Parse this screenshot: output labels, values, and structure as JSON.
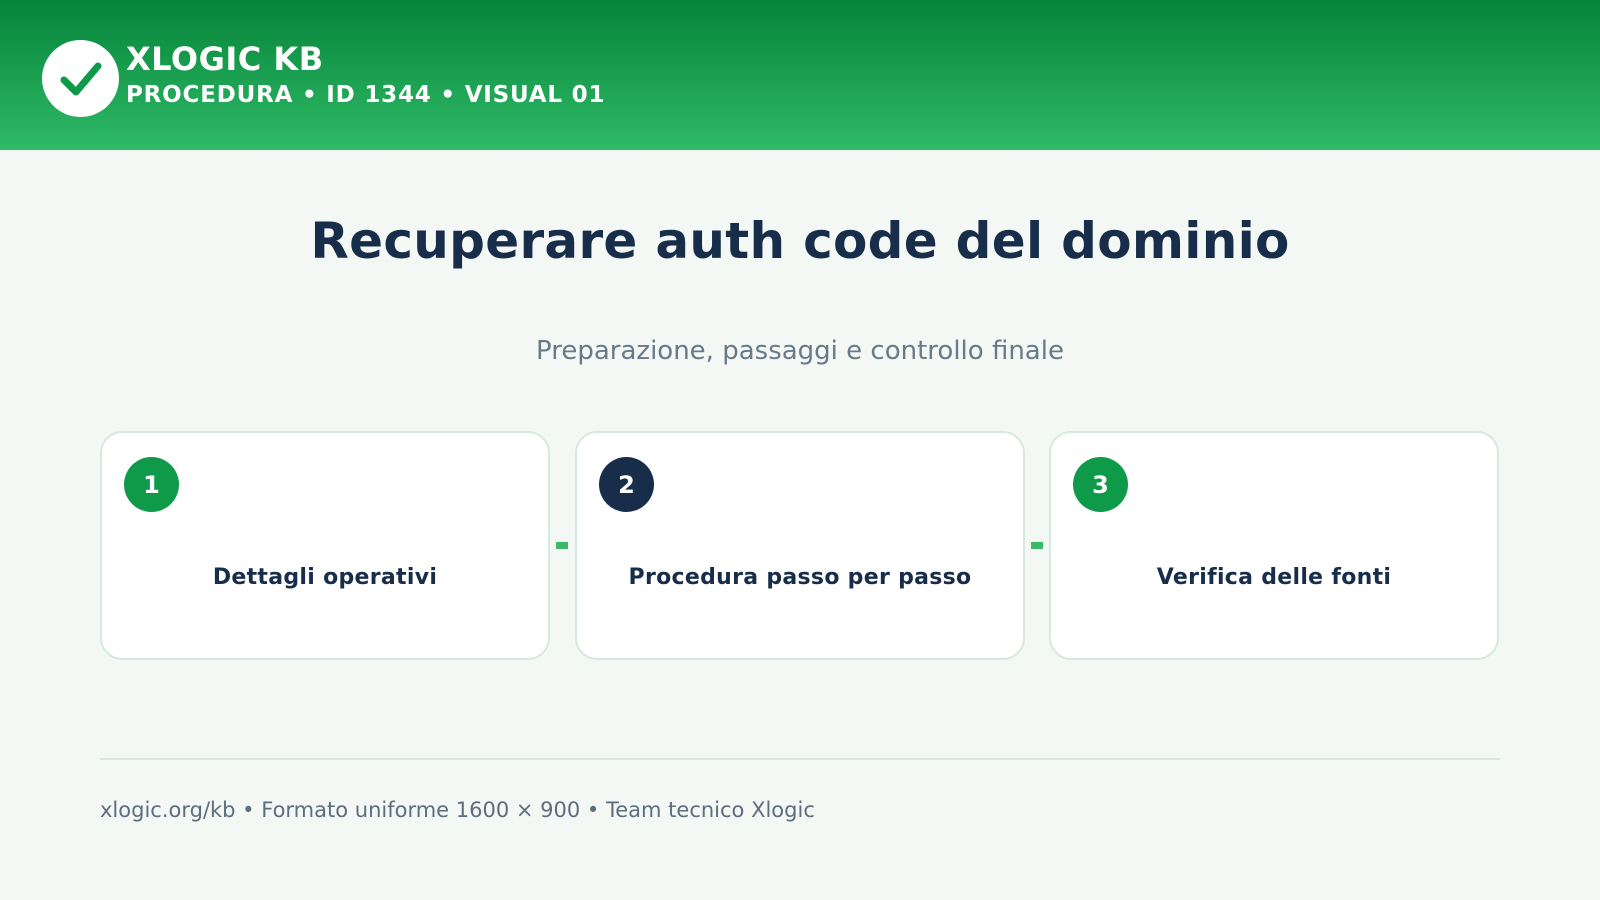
{
  "header": {
    "brand": "XLOGIC KB",
    "meta": "PROCEDURA • ID 1344 • VISUAL 01",
    "logo_icon": "check-icon"
  },
  "main": {
    "title": "Recuperare auth code del dominio",
    "subtitle": "Preparazione, passaggi e controllo finale"
  },
  "steps": [
    {
      "number": "1",
      "label": "Dettagli operativi",
      "badge_color": "#0f9a4a"
    },
    {
      "number": "2",
      "label": "Procedura passo per passo",
      "badge_color": "#172d4a"
    },
    {
      "number": "3",
      "label": "Verifica delle fonti",
      "badge_color": "#0f9a4a"
    }
  ],
  "footer": {
    "text": "xlogic.org/kb • Formato uniforme 1600 × 900 • Team tecnico Xlogic"
  },
  "colors": {
    "header_dark": "#06843a",
    "header_light": "#2fba66",
    "title": "#172d4a",
    "accent": "#0f9a4a",
    "connector": "#3cba6a"
  }
}
